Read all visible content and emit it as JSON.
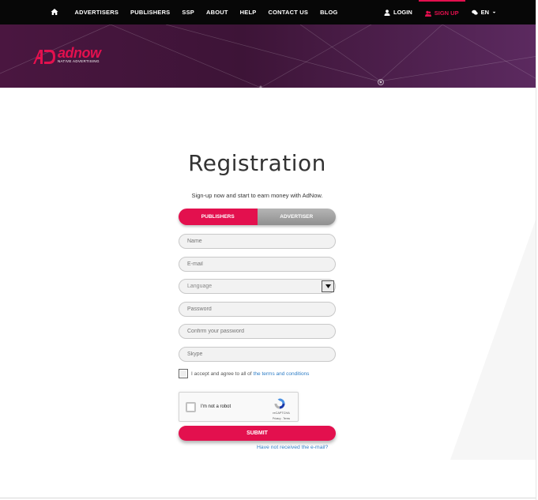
{
  "nav": {
    "home_icon": "home-icon",
    "items": [
      "ADVERTISERS",
      "PUBLISHERS",
      "SSP",
      "ABOUT",
      "HELP",
      "CONTACT US",
      "BLOG"
    ],
    "login": "LOGIN",
    "signup": "SIGN UP",
    "language": "EN"
  },
  "brand": {
    "name": "adnow",
    "tagline": "NATIVE ADVERTISING",
    "accent_color": "#e3104e",
    "banner_color": "#4a1640"
  },
  "page": {
    "title": "Registration",
    "subtitle": "Sign-up now and start to earn money with AdNow."
  },
  "tabs": [
    {
      "label": "PUBLISHERS",
      "active": true
    },
    {
      "label": "ADVERTISER",
      "active": false
    }
  ],
  "form": {
    "name_placeholder": "Name",
    "email_placeholder": "E-mail",
    "language_value": "Language",
    "password_placeholder": "Password",
    "confirm_placeholder": "Confirm your password",
    "skype_placeholder": "Skype",
    "terms_text": "I accept and agree to all of",
    "terms_link": "the terms and conditions",
    "submit_label": "SUBMIT",
    "resend_link": "Have not received the e-mail?"
  },
  "captcha": {
    "label": "I'm not a robot",
    "brand": "reCAPTCHA",
    "links": "Privacy - Terms"
  }
}
